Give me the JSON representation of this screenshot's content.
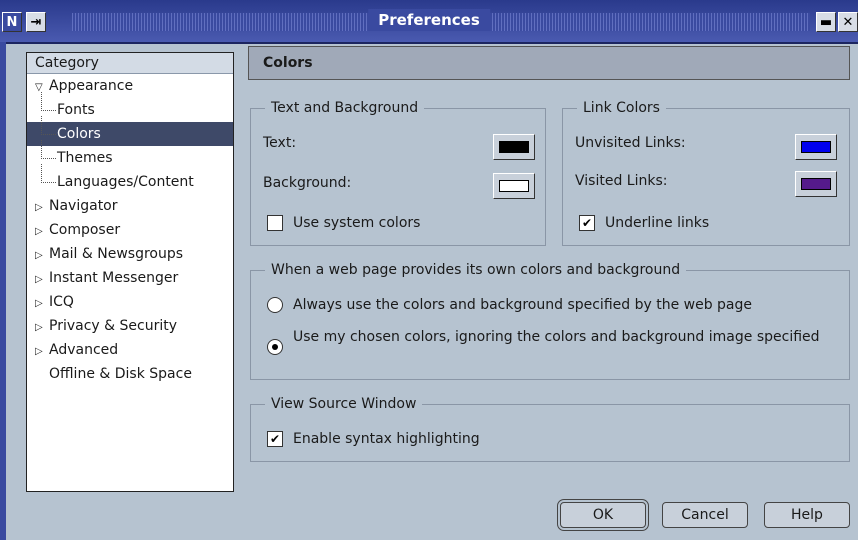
{
  "window": {
    "title": "Preferences"
  },
  "category": {
    "header": "Category",
    "items": [
      {
        "label": "Appearance",
        "expand": "open"
      },
      {
        "label": "Fonts"
      },
      {
        "label": "Colors"
      },
      {
        "label": "Themes"
      },
      {
        "label": "Languages/Content"
      },
      {
        "label": "Navigator",
        "expand": "closed"
      },
      {
        "label": "Composer",
        "expand": "closed"
      },
      {
        "label": "Mail & Newsgroups",
        "expand": "closed"
      },
      {
        "label": "Instant Messenger",
        "expand": "closed"
      },
      {
        "label": "ICQ",
        "expand": "closed"
      },
      {
        "label": "Privacy & Security",
        "expand": "closed"
      },
      {
        "label": "Advanced",
        "expand": "closed"
      },
      {
        "label": "Offline & Disk Space"
      }
    ],
    "selected": "Colors"
  },
  "panel": {
    "title": "Colors",
    "text_bg": {
      "legend": "Text and Background",
      "text_label": "Text:",
      "text_color": "#000000",
      "background_label": "Background:",
      "background_color": "#ffffff",
      "system_colors_label": "Use system colors",
      "system_colors_checked": false
    },
    "link_colors": {
      "legend": "Link Colors",
      "unvisited_label": "Unvisited Links:",
      "unvisited_color": "#0000ee",
      "visited_label": "Visited Links:",
      "visited_color": "#551a8b",
      "underline_label": "Underline links",
      "underline_checked": true
    },
    "page_colors": {
      "legend": "When a web page provides its own colors and background",
      "option1": "Always use the colors and background specified by the web page",
      "option2": "Use my chosen colors, ignoring the colors and background image specified",
      "selected": 2
    },
    "view_source": {
      "legend": "View Source Window",
      "syntax_label": "Enable syntax highlighting",
      "syntax_checked": true
    }
  },
  "buttons": {
    "ok": "OK",
    "cancel": "Cancel",
    "help": "Help"
  },
  "icons": {
    "check": "✔",
    "arrow_open": "▽",
    "arrow_closed": "▷"
  }
}
